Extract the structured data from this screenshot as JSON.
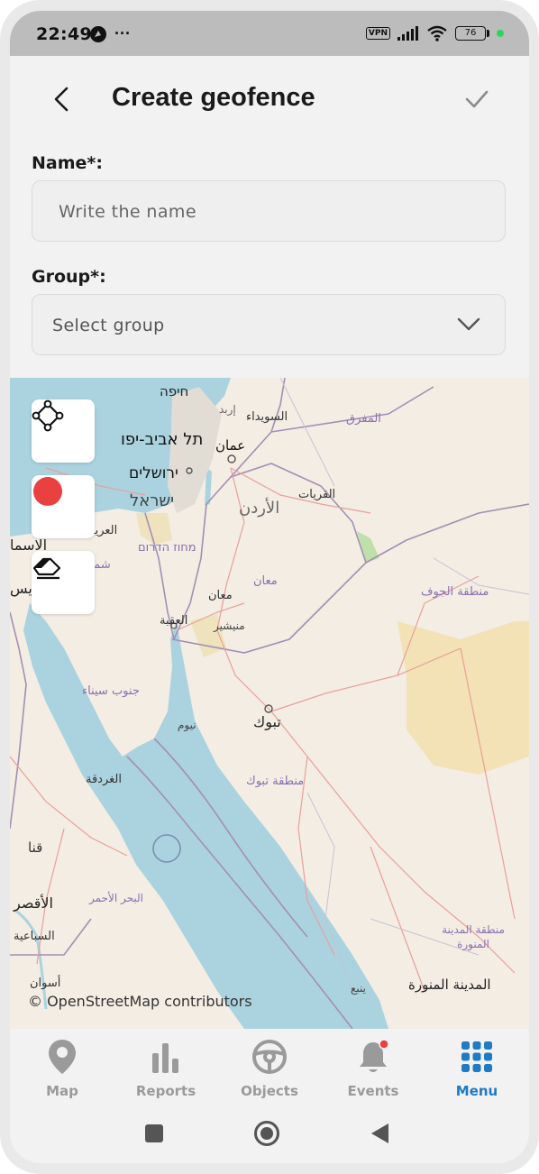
{
  "status_bar": {
    "time": "22:49",
    "dots": "···",
    "vpn": "VPN",
    "battery": "76"
  },
  "header": {
    "title": "Create geofence"
  },
  "form": {
    "name_label": "Name*:",
    "name_placeholder": "Write the name",
    "group_label": "Group*:",
    "group_placeholder": "Select group"
  },
  "map": {
    "attribution": "© OpenStreetMap contributors",
    "labels": {
      "haifa": "חיפה",
      "irbid": "إربد",
      "sweida": "السويداء",
      "mafraq": "المفرق",
      "tel_aviv": "תל אביב-יפו",
      "amman": "عمان",
      "jerusalem": "ירושלים",
      "israel": "ישראל",
      "qurayyat": "القريات",
      "jordan": "الأردن",
      "arish": "العريش",
      "ismailia": "الاسما",
      "south_district": "מחוז הדרום",
      "north_sinai": "شمال",
      "maan_region": "معان",
      "maan": "معان",
      "jouf": "منطقة الجوف",
      "suez": "ويس",
      "aqaba": "العقبة",
      "munaysir": "منيشير",
      "south_sinai": "جنوب سيناء",
      "tabuk": "تبوك",
      "neom": "نيوم",
      "hurghada": "الغردقة",
      "tabuk_region": "منطقة تبوك",
      "qena": "قنا",
      "luxor": "الأقصر",
      "red_sea": "البحر الأحمر",
      "medina_region": "منطقة المدينة المنورة",
      "sibaiya": "السباعية",
      "aswan": "أسوان",
      "yanbu": "ينبع",
      "medina": "المدينة المنورة"
    }
  },
  "nav": {
    "items": [
      {
        "label": "Map"
      },
      {
        "label": "Reports"
      },
      {
        "label": "Objects"
      },
      {
        "label": "Events"
      },
      {
        "label": "Menu"
      }
    ]
  },
  "colors": {
    "accent": "#1f7bc4",
    "record": "#e94040",
    "sea": "#aad3df",
    "land": "#f3ede3"
  }
}
